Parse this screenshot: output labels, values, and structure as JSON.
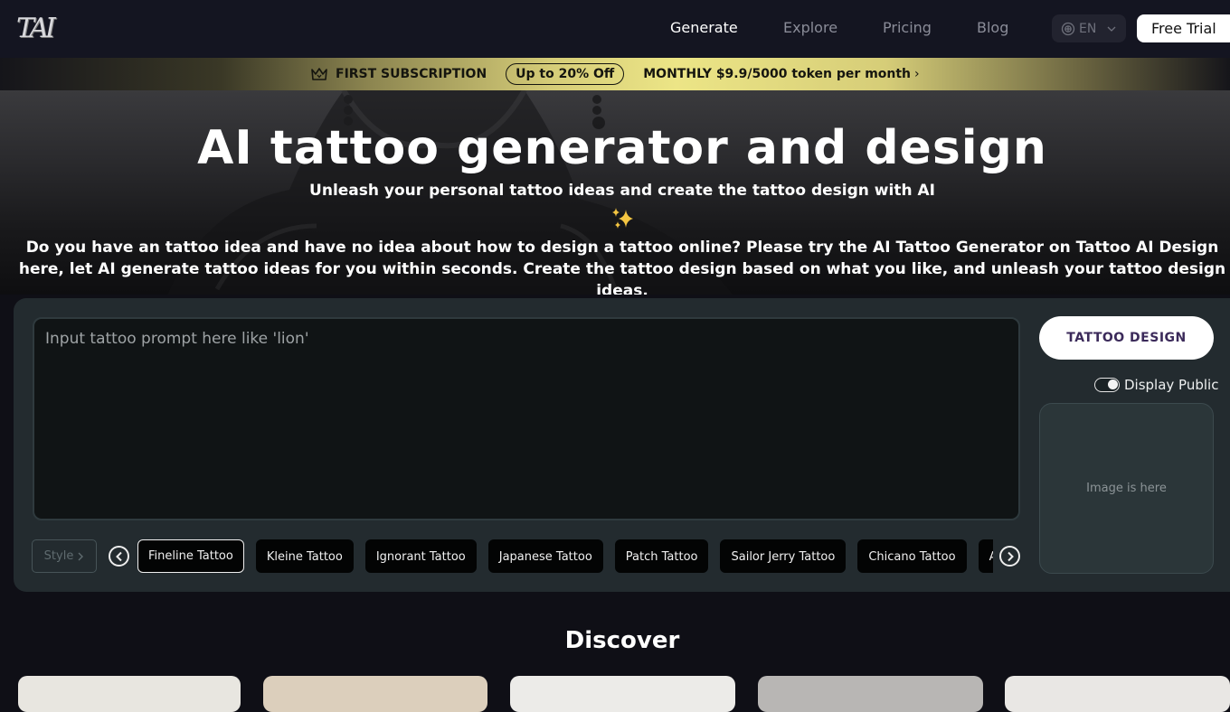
{
  "header": {
    "logo_text": "TAI",
    "nav": [
      {
        "label": "Generate",
        "active": true
      },
      {
        "label": "Explore",
        "active": false
      },
      {
        "label": "Pricing",
        "active": false
      },
      {
        "label": "Blog",
        "active": false
      }
    ],
    "language": {
      "icon": "globe-icon",
      "value": "EN"
    },
    "cta_label": "Free Trial"
  },
  "promo": {
    "icon": "crown-icon",
    "headline": "FIRST SUBSCRIPTION",
    "badge": "Up to 20% Off",
    "offer": "MONTHLY $9.9/5000 token per month",
    "chevron": "›"
  },
  "hero": {
    "title": "AI tattoo generator and design",
    "subtitle": "Unleash your personal tattoo ideas and create the tattoo design with AI",
    "sparkle_icon": "sparkles-icon",
    "description": "Do you have an tattoo idea and have no idea about how to design a tattoo online? Please try the AI Tattoo Generator on Tattoo AI Design here, let AI generate tattoo ideas for you within seconds. Create the tattoo design based on what you like, and unleash your tattoo design ideas."
  },
  "generator": {
    "prompt_value": "",
    "prompt_placeholder": "Input tattoo prompt here like 'lion'",
    "submit_label": "TATTOO DESIGN",
    "display_public": {
      "label": "Display Public",
      "enabled": true
    },
    "image_placeholder": "Image is here",
    "style_label": "Style",
    "styles": [
      {
        "label": "Fineline Tattoo",
        "selected": true
      },
      {
        "label": "Kleine Tattoo",
        "selected": false
      },
      {
        "label": "Ignorant Tattoo",
        "selected": false
      },
      {
        "label": "Japanese Tattoo",
        "selected": false
      },
      {
        "label": "Patch Tattoo",
        "selected": false
      },
      {
        "label": "Sailor Jerry Tattoo",
        "selected": false
      },
      {
        "label": "Chicano Tattoo",
        "selected": false
      },
      {
        "label": "Anchor Tattoo",
        "selected": false
      }
    ]
  },
  "discover": {
    "title": "Discover",
    "cards": [
      {
        "tone": "#e8e6e0"
      },
      {
        "tone": "#dccfbc"
      },
      {
        "tone": "#ecebe8"
      },
      {
        "tone": "#b8b6b4"
      },
      {
        "tone": "#e9e7e4"
      }
    ]
  },
  "colors": {
    "header_bg": "#141521",
    "page_bg": "#0f0f16",
    "panel_bg": "#232b2f",
    "promo_gold": "#ece586",
    "button_text": "#3b2a5a"
  }
}
